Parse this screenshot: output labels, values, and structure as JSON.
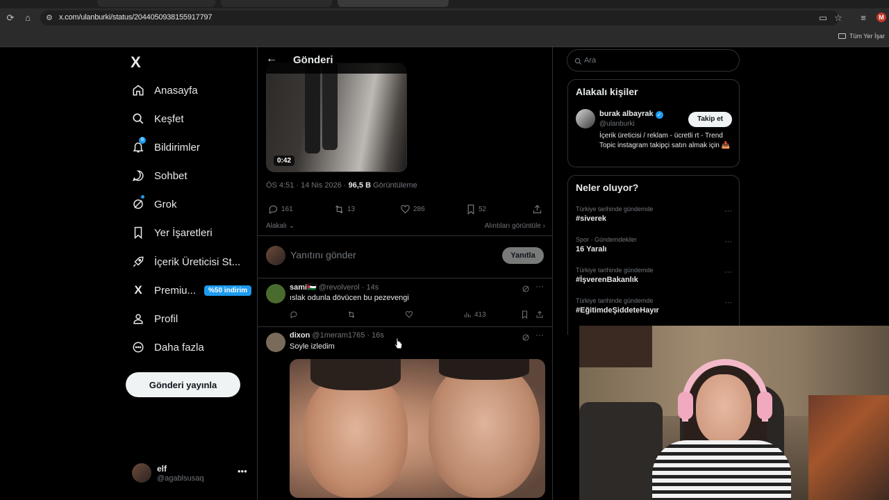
{
  "browser": {
    "url": "x.com/ulanburki/status/2044050938155917797",
    "bookmark": "Tüm Yer İşar",
    "profile_initial": "M"
  },
  "nav": {
    "logo": "X",
    "items": [
      {
        "label": "Anasayfa",
        "icon": "home-icon"
      },
      {
        "label": "Keşfet",
        "icon": "search-icon"
      },
      {
        "label": "Bildirimler",
        "icon": "bell-icon",
        "badge": "9"
      },
      {
        "label": "Sohbet",
        "icon": "chat-icon"
      },
      {
        "label": "Grok",
        "icon": "grok-icon"
      },
      {
        "label": "Yer İşaretleri",
        "icon": "bookmark-icon"
      },
      {
        "label": "İçerik Üreticisi St...",
        "icon": "rocket-icon"
      },
      {
        "label": "Premiu...",
        "icon": "x-icon",
        "promo": "%50 indirim"
      },
      {
        "label": "Profil",
        "icon": "person-icon"
      },
      {
        "label": "Daha fazla",
        "icon": "more-circle-icon"
      }
    ],
    "post_button": "Gönderi yayınla",
    "account": {
      "name": "elf",
      "handle": "@agablsusaq"
    }
  },
  "post": {
    "header_title": "Gönderi",
    "video_duration": "0:42",
    "time": "ÖS 4:51 · 14 Nis 2026 · ",
    "views": "96,5 B",
    "views_label": " Görüntüleme",
    "stats": {
      "replies": "161",
      "reposts": "13",
      "likes": "286",
      "bookmarks": "52"
    },
    "sort_label": "Alakalı",
    "quotes_link": "Alıntıları görüntüle",
    "reply_placeholder": "Yanıtını gönder",
    "reply_button": "Yanıtla"
  },
  "replies": [
    {
      "name": "sami🇵🇸",
      "handle": "@revolverol · 14s",
      "text": "ıslak odunla dövücen bu pezevengi",
      "views": "413",
      "avatar_color": "#4a6b2e"
    },
    {
      "name": "dixon",
      "handle": "@1meram1765 · 16s",
      "text": "Soyle izledim",
      "avatar_color": "#7a6a5a"
    }
  ],
  "sidebar": {
    "search_placeholder": "Ara",
    "related_title": "Alakalı kişiler",
    "person": {
      "name": "burak albayrak",
      "handle": "@ulanburki",
      "bio": "İçerik üreticisi / reklam - ücretli rt - Trend Topic instagram takipçi satın almak için 📥",
      "follow": "Takip et"
    },
    "trends_title": "Neler oluyor?",
    "trends": [
      {
        "context": "Türkiye tarihinde gündemde",
        "name": "#siverek"
      },
      {
        "context": "Spor · Gündemdekiler",
        "name": "16 Yaralı"
      },
      {
        "context": "Türkiye tarihinde gündemde",
        "name": "#İşverenBakanlık"
      },
      {
        "context": "Türkiye tarihinde gündemde",
        "name": "#EğitimdeŞiddeteHayır"
      }
    ]
  }
}
